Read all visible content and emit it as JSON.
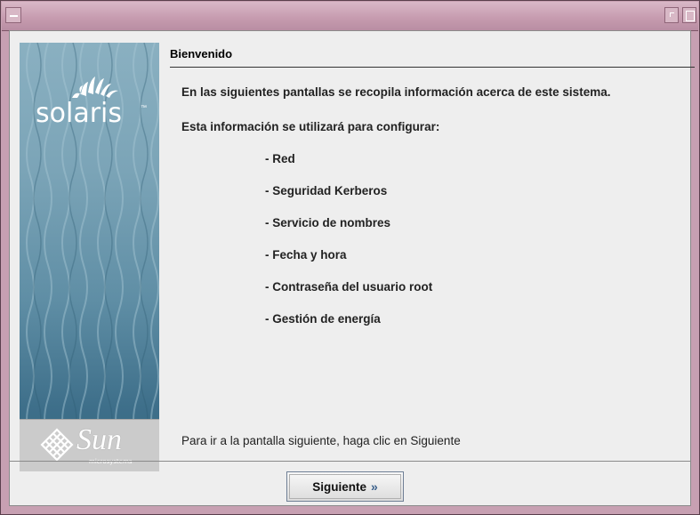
{
  "window": {
    "menu_icon": "window-menu-icon",
    "minimize_icon": "window-minimize-icon",
    "maximize_icon": "window-maximize-icon",
    "title": ""
  },
  "branding": {
    "product": "solaris",
    "product_tm": "™",
    "vendor": "Sun",
    "vendor_sub": "microsystems"
  },
  "content": {
    "heading": "Bienvenido",
    "intro": "En las siguientes pantallas se recopila información acerca de este sistema.",
    "config_intro": "Esta información se utilizará para configurar:",
    "items": [
      "- Red",
      "- Seguridad Kerberos",
      "- Servicio de nombres",
      "- Fecha y hora",
      "- Contraseña del usuario root",
      "- Gestión de energía"
    ],
    "footer_hint": "Para ir a la pantalla siguiente, haga clic en Siguiente"
  },
  "buttons": {
    "next_label": "Siguiente",
    "next_icon": "double-chevron-right-icon"
  },
  "colors": {
    "window_frame": "#c7a0b2",
    "client_bg": "#eeeeee",
    "panel_blue": "#5f8ea5",
    "sun_gray": "#cbcbcb"
  }
}
